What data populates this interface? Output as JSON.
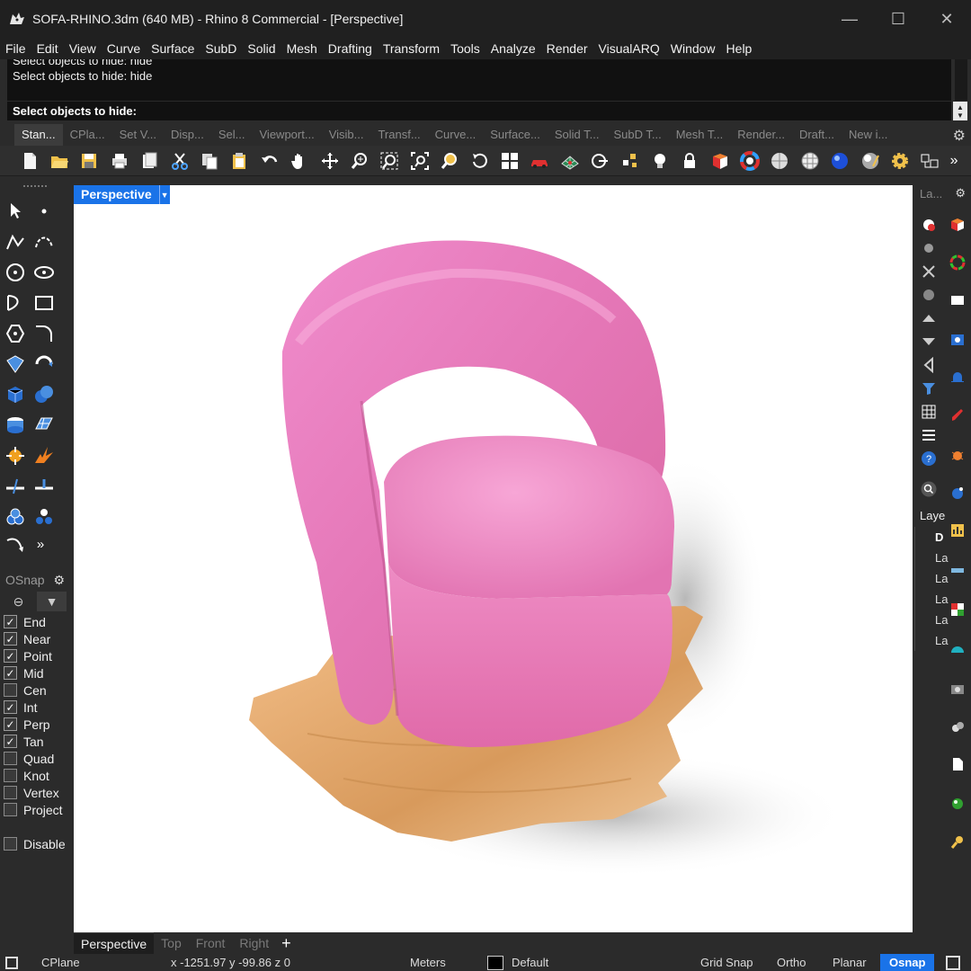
{
  "window": {
    "title": "SOFA-RHINO.3dm (640 MB) - Rhino 8 Commercial - [Perspective]",
    "minimize": "—",
    "maximize": "☐",
    "close": "✕"
  },
  "menu": [
    "File",
    "Edit",
    "View",
    "Curve",
    "Surface",
    "SubD",
    "Solid",
    "Mesh",
    "Drafting",
    "Transform",
    "Tools",
    "Analyze",
    "Render",
    "VisualARQ",
    "Window",
    "Help"
  ],
  "command": {
    "history": [
      "Select objects to hide: hide",
      "Select objects to hide: hide"
    ],
    "prompt": "Select objects to hide:"
  },
  "toolbar_tabs": [
    "Stan...",
    "CPla...",
    "Set V...",
    "Disp...",
    "Sel...",
    "Viewport...",
    "Visib...",
    "Transf...",
    "Curve...",
    "Surface...",
    "Solid T...",
    "SubD T...",
    "Mesh T...",
    "Render...",
    "Draft...",
    "New i..."
  ],
  "toolbar_icons": [
    "new-file-icon",
    "open-folder-icon",
    "save-icon",
    "print-icon",
    "import-icon",
    "cut-icon",
    "copy-icon",
    "paste-icon",
    "undo-icon",
    "pan-hand-icon",
    "rotate-view-icon",
    "zoom-icon",
    "zoom-window-icon",
    "zoom-extents-icon",
    "zoom-selected-icon",
    "rotate-icon",
    "four-viewports-icon",
    "car-render-icon",
    "grid-surface-icon",
    "cplane-icon",
    "points-icon",
    "light-bulb-icon",
    "lock-icon",
    "material-icon",
    "color-wheel-icon",
    "sphere-icon",
    "mesh-sphere-icon",
    "render-sphere-icon",
    "chrome-sphere-icon",
    "gear-yellow-icon",
    "layout-icon"
  ],
  "toolbar_more": "»",
  "viewport": {
    "label": "Perspective",
    "tabs": [
      "Perspective",
      "Top",
      "Front",
      "Right"
    ],
    "add_tab": "+"
  },
  "osnap": {
    "title": "OSnap",
    "items": [
      {
        "label": "End",
        "checked": true
      },
      {
        "label": "Near",
        "checked": true
      },
      {
        "label": "Point",
        "checked": true
      },
      {
        "label": "Mid",
        "checked": true
      },
      {
        "label": "Cen",
        "checked": false
      },
      {
        "label": "Int",
        "checked": true
      },
      {
        "label": "Perp",
        "checked": true
      },
      {
        "label": "Tan",
        "checked": true
      },
      {
        "label": "Quad",
        "checked": false
      },
      {
        "label": "Knot",
        "checked": false
      },
      {
        "label": "Vertex",
        "checked": false
      },
      {
        "label": "Project",
        "checked": false
      }
    ],
    "disable": {
      "label": "Disable",
      "checked": false
    }
  },
  "right_panel": {
    "tab": "La...",
    "layers_header": "Laye",
    "layers": [
      "D",
      "La",
      "La",
      "La",
      "La",
      "La"
    ]
  },
  "status": {
    "cplane": "CPlane",
    "coords": "x -1251.97  y -99.86  z 0",
    "units": "Meters",
    "layer": "Default",
    "grid_snap": "Grid Snap",
    "ortho": "Ortho",
    "planar": "Planar",
    "osnap": "Osnap"
  },
  "colors": {
    "accent": "#1a73e8",
    "chair": "#e67fb3",
    "base": "#f0b27a"
  }
}
